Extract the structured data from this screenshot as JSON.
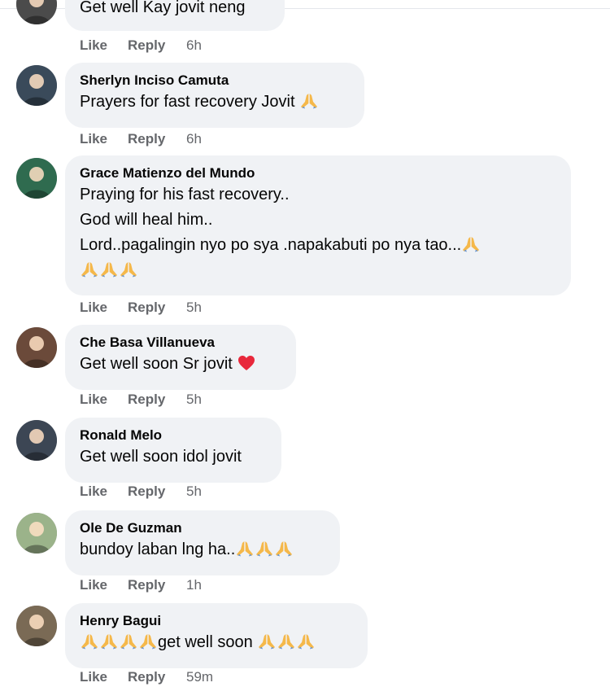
{
  "comments": [
    {
      "id": "c0",
      "author": "",
      "lines": [
        [
          {
            "t": "Get well Kay jovit neng"
          }
        ]
      ],
      "time": "6h",
      "avatar_color": "#4b4b4b"
    },
    {
      "id": "c1",
      "author": "Sherlyn Inciso Camuta",
      "lines": [
        [
          {
            "t": "Prayers for fast recovery Jovit "
          },
          {
            "e": "pray"
          }
        ]
      ],
      "time": "6h",
      "avatar_color": "#3a4a5a"
    },
    {
      "id": "c2",
      "author": "Grace Matienzo del Mundo",
      "lines": [
        [
          {
            "t": "Praying for his fast recovery.."
          }
        ],
        [
          {
            "t": "God will heal him.."
          }
        ],
        [
          {
            "t": "Lord..pagalingin nyo po sya .napakabuti po nya tao..."
          },
          {
            "e": "pray"
          }
        ],
        [
          {
            "e": "pray"
          },
          {
            "e": "pray"
          },
          {
            "e": "pray"
          }
        ]
      ],
      "time": "5h",
      "avatar_color": "#2f6b4f"
    },
    {
      "id": "c3",
      "author": "Che Basa Villanueva",
      "lines": [
        [
          {
            "t": "Get well soon Sr jovit "
          },
          {
            "e": "heart"
          }
        ]
      ],
      "time": "5h",
      "avatar_color": "#6b4a3a"
    },
    {
      "id": "c4",
      "author": "Ronald Melo",
      "lines": [
        [
          {
            "t": "Get well soon idol jovit"
          }
        ]
      ],
      "time": "5h",
      "avatar_color": "#3c4654"
    },
    {
      "id": "c5",
      "author": "Ole De Guzman",
      "lines": [
        [
          {
            "t": "bundoy laban lng ha.."
          },
          {
            "e": "pray"
          },
          {
            "e": "pray"
          },
          {
            "e": "pray"
          }
        ]
      ],
      "time": "1h",
      "avatar_color": "#9bb38a"
    },
    {
      "id": "c6",
      "author": "Henry Bagui",
      "lines": [
        [
          {
            "e": "pray"
          },
          {
            "e": "pray"
          },
          {
            "e": "pray"
          },
          {
            "e": "pray"
          },
          {
            "t": "get well soon "
          },
          {
            "e": "pray"
          },
          {
            "e": "pray"
          },
          {
            "e": "pray"
          }
        ]
      ],
      "time": "59m",
      "avatar_color": "#7a6a55"
    }
  ],
  "actions": {
    "like_label": "Like",
    "reply_label": "Reply"
  },
  "colors": {
    "bubble_bg": "#f0f2f5",
    "meta_text": "#65676b",
    "pray_emoji": "#f5b84a",
    "heart_emoji": "#e8283b"
  },
  "icons": {
    "pray": "folded-hands-emoji",
    "heart": "red-heart-emoji"
  }
}
